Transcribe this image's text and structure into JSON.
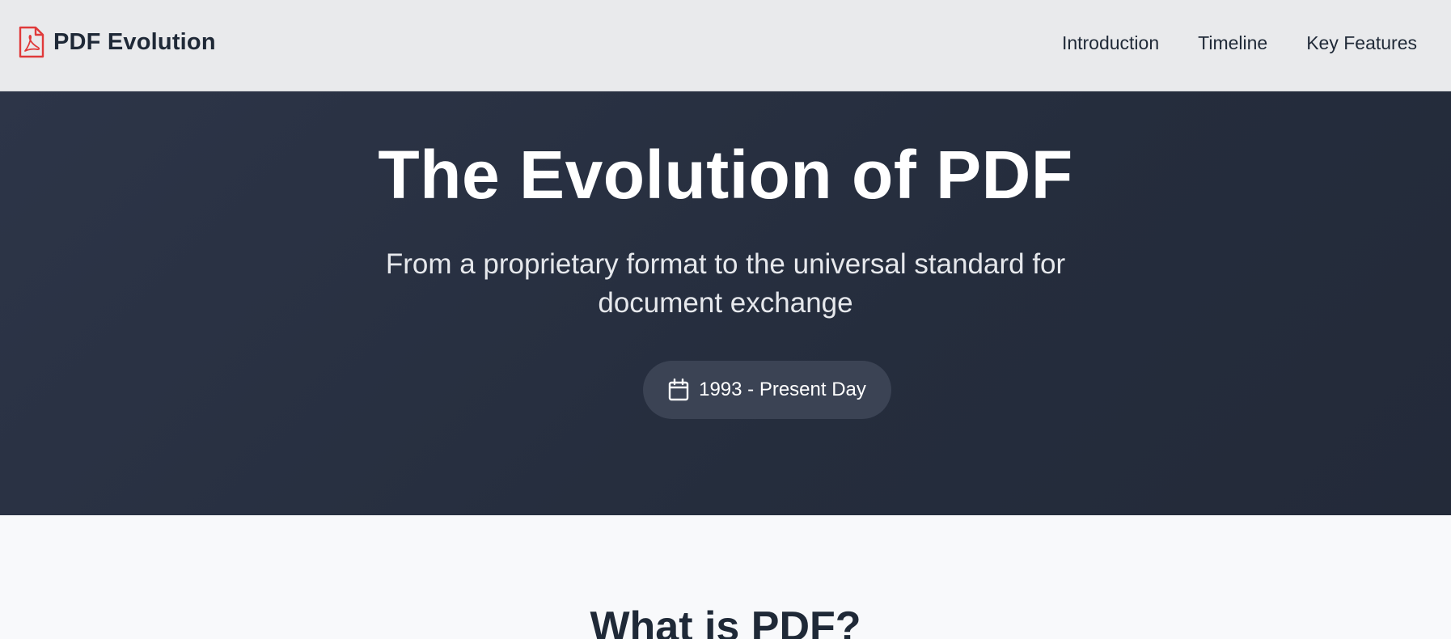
{
  "header": {
    "brand": "PDF Evolution",
    "brand_icon": "pdf-file-icon",
    "brand_color": "#e03a3a",
    "nav": [
      {
        "label": "Introduction"
      },
      {
        "label": "Timeline"
      },
      {
        "label": "Key Features"
      }
    ]
  },
  "hero": {
    "title": "The Evolution of PDF",
    "subtitle": "From a proprietary format to the universal standard for document exchange",
    "date_range": "1993 - Present Day",
    "date_icon": "calendar-icon"
  },
  "section": {
    "title": "What is PDF?"
  },
  "colors": {
    "header_bg": "#e9eaec",
    "hero_bg": "#2a3244",
    "pill_bg": "#3b4354",
    "text_dark": "#1f2937"
  }
}
